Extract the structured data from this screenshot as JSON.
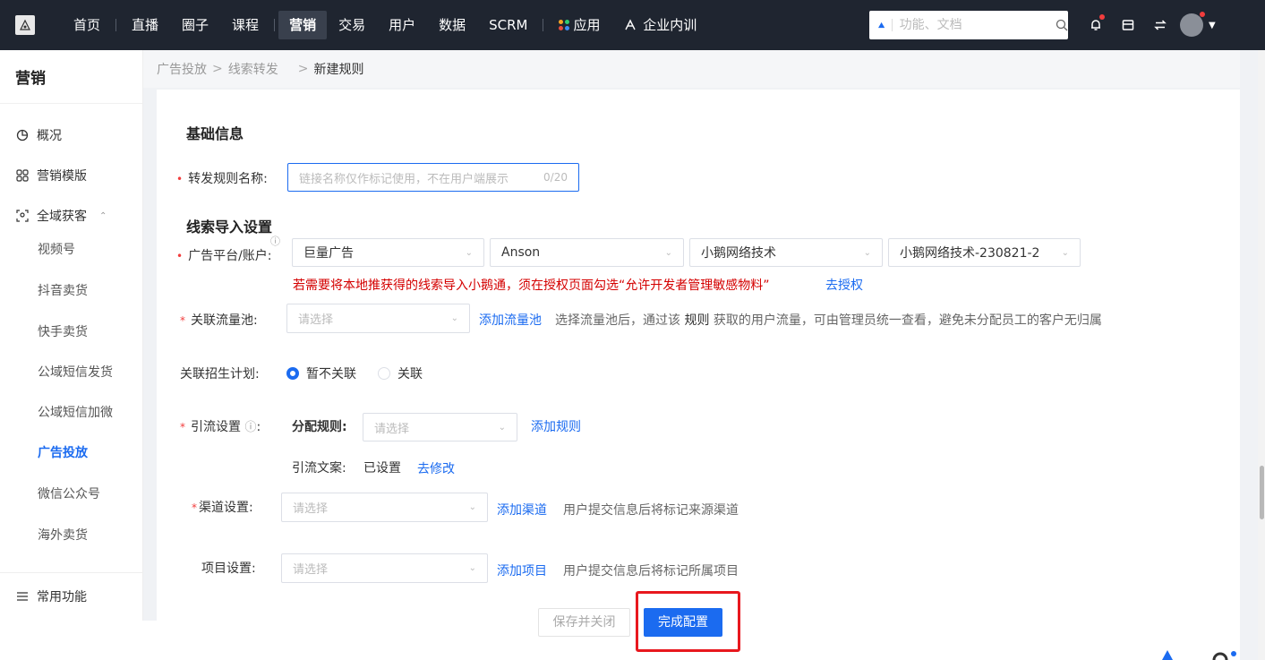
{
  "topnav": {
    "logo_icon": "app-logo-icon",
    "items": [
      {
        "label": "首页"
      },
      {
        "label": "直播"
      },
      {
        "label": "圈子"
      },
      {
        "label": "课程"
      },
      {
        "label": "营销",
        "active": true
      },
      {
        "label": "交易"
      },
      {
        "label": "用户"
      },
      {
        "label": "数据"
      },
      {
        "label": "SCRM"
      },
      {
        "label": "应用"
      },
      {
        "label": "企业内训"
      }
    ],
    "search_placeholder": "功能、文档",
    "icons": [
      "bell-icon",
      "store-icon",
      "switch-icon"
    ]
  },
  "sidebar": {
    "title": "营销",
    "items": [
      {
        "label": "概况",
        "icon": "pie-chart-icon"
      },
      {
        "label": "营销模版",
        "icon": "grid-icon"
      },
      {
        "label": "全域获客",
        "icon": "scan-user-icon"
      }
    ],
    "sub_items": [
      {
        "label": "视频号"
      },
      {
        "label": "抖音卖货"
      },
      {
        "label": "快手卖货"
      },
      {
        "label": "公域短信发货"
      },
      {
        "label": "公域短信加微"
      },
      {
        "label": "广告投放",
        "active": true
      },
      {
        "label": "微信公众号"
      },
      {
        "label": "海外卖货"
      }
    ],
    "common": {
      "label": "常用功能",
      "icon": "list-icon"
    }
  },
  "breadcrumb": {
    "items": [
      "广告投放",
      "线索转发"
    ],
    "current": "新建规则"
  },
  "form": {
    "basic_title": "基础信息",
    "rule_name_label": "转发规则名称:",
    "rule_name_placeholder": "链接名称仅作标记使用，不在用户端展示",
    "rule_name_count": "0/20",
    "import_title": "线索导入设置",
    "platform_label": "广告平台/账户:",
    "platform_values": [
      "巨量广告",
      "Anson",
      "小鹅网络技术",
      "小鹅网络技术-230821-2"
    ],
    "warning": "若需要将本地推获得的线索导入小鹅通，须在授权页面勾选“允许开发者管理敏感物料”",
    "authorize_link": "去授权",
    "pool_label": "关联流量池:",
    "pool_placeholder": "请选择",
    "add_pool": "添加流量池",
    "pool_note_a": "选择流量池后，通过该",
    "pool_note_b": "规则",
    "pool_note_c": "获取的用户流量，可由管理员统一查看，避免未分配员工的客户无归属",
    "plan_label": "关联招生计划:",
    "plan_options": [
      "暂不关联",
      "关联"
    ],
    "guide_label": "引流设置",
    "guide_info_icon": "info-icon",
    "assign_label": "分配规则:",
    "assign_placeholder": "请选择",
    "add_rule": "添加规则",
    "copy_label": "引流文案:",
    "copy_status": "已设置",
    "copy_edit": "去修改",
    "channel_label": "渠道设置:",
    "channel_placeholder": "请选择",
    "add_channel": "添加渠道",
    "channel_note": "用户提交信息后将标记来源渠道",
    "project_label": "项目设置:",
    "project_placeholder": "请选择",
    "add_project": "添加项目",
    "project_note": "用户提交信息后将标记所属项目",
    "save_close": "保存并关闭",
    "finish": "完成配置"
  }
}
